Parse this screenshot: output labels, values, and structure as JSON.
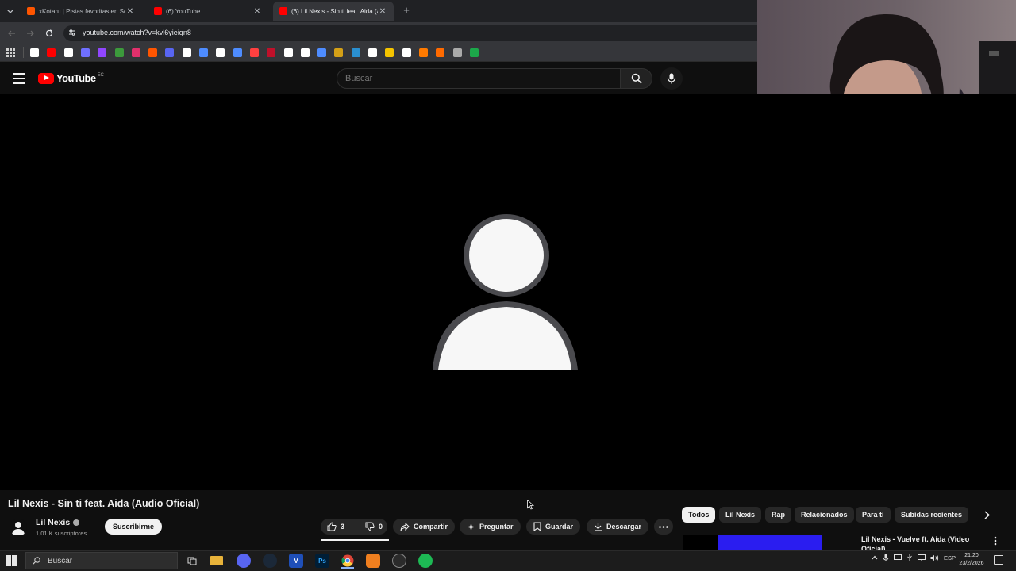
{
  "browser": {
    "tabs": [
      {
        "title": "xKotaru | Pistas favoritas en So",
        "favicon_color": "#ff5500",
        "active": false
      },
      {
        "title": "(6) YouTube",
        "favicon_color": "#ff0000",
        "active": false
      },
      {
        "title": "(6) Lil Nexis - Sin ti feat. Aida (A",
        "favicon_color": "#ff0000",
        "active": true
      }
    ],
    "new_tab_label": "+",
    "url": "youtube.com/watch?v=kvl6yieiqn8",
    "bookmark_colors": [
      "#ffffff",
      "#ff0000",
      "#ffffff",
      "#6f6fff",
      "#9146ff",
      "#3c9a3c",
      "#e1306c",
      "#ff5500",
      "#5865f2",
      "#ffffff",
      "#4e8cff",
      "#ffffff",
      "#4e8cff",
      "#ff4040",
      "#c0102a",
      "#ffffff",
      "#ffffff",
      "#4e8cff",
      "#d4a017",
      "#2a8fd0",
      "#ffffff",
      "#f5c400",
      "#ffffff",
      "#ff7a00",
      "#ff6a00",
      "#aaaaaa",
      "#1ca84a"
    ]
  },
  "youtube": {
    "logo_text": "YouTube",
    "country_code": "EC",
    "search_placeholder": "Buscar",
    "video_title": "Lil Nexis - Sin ti feat. Aida (Audio Oficial)",
    "channel_name": "Lil Nexis",
    "subscribers": "1,01 K suscriptores",
    "subscribe_label": "Suscribirme",
    "likes": "3",
    "dislikes": "0",
    "share_label": "Compartir",
    "ask_label": "Preguntar",
    "save_label": "Guardar",
    "download_label": "Descargar",
    "chips": [
      "Todos",
      "Lil Nexis",
      "Rap",
      "Relacionados",
      "Para ti",
      "Subidas recientes"
    ],
    "recommendation_title": "Lil Nexis - Vuelve ft. Aida (Video Oficial)"
  },
  "taskbar": {
    "search_placeholder": "Buscar",
    "language": "ESP",
    "time": "21:20",
    "date": "23/2/2026"
  }
}
